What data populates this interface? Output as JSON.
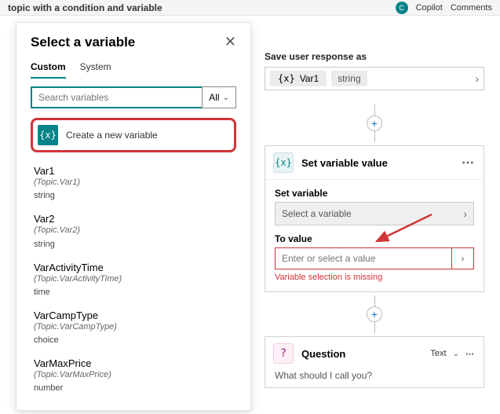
{
  "topbar": {
    "title_fragment": "topic with a condition and variable",
    "copilot": "Copilot",
    "comments": "Comments"
  },
  "panel": {
    "title": "Select a variable",
    "tabs": {
      "custom": "Custom",
      "system": "System"
    },
    "search_placeholder": "Search variables",
    "all_label": "All",
    "create_label": "Create a new variable",
    "vars": [
      {
        "name": "Var1",
        "path": "(Topic.Var1)",
        "type": "string"
      },
      {
        "name": "Var2",
        "path": "(Topic.Var2)",
        "type": "string"
      },
      {
        "name": "VarActivityTime",
        "path": "(Topic.VarActivityTime)",
        "type": "time"
      },
      {
        "name": "VarCampType",
        "path": "(Topic.VarCampType)",
        "type": "choice"
      },
      {
        "name": "VarMaxPrice",
        "path": "(Topic.VarMaxPrice)",
        "type": "number"
      }
    ]
  },
  "save_response": {
    "label": "Save user response as",
    "var_name": "Var1",
    "var_type": "string"
  },
  "set_var_node": {
    "title": "Set variable value",
    "set_label": "Set variable",
    "select_placeholder": "Select a variable",
    "to_label": "To value",
    "value_placeholder": "Enter or select a value",
    "error": "Variable selection is missing"
  },
  "question_node": {
    "title": "Question",
    "type_label": "Text",
    "prompt": "What should I call you?"
  },
  "glyphs": {
    "varx": "{x}"
  }
}
